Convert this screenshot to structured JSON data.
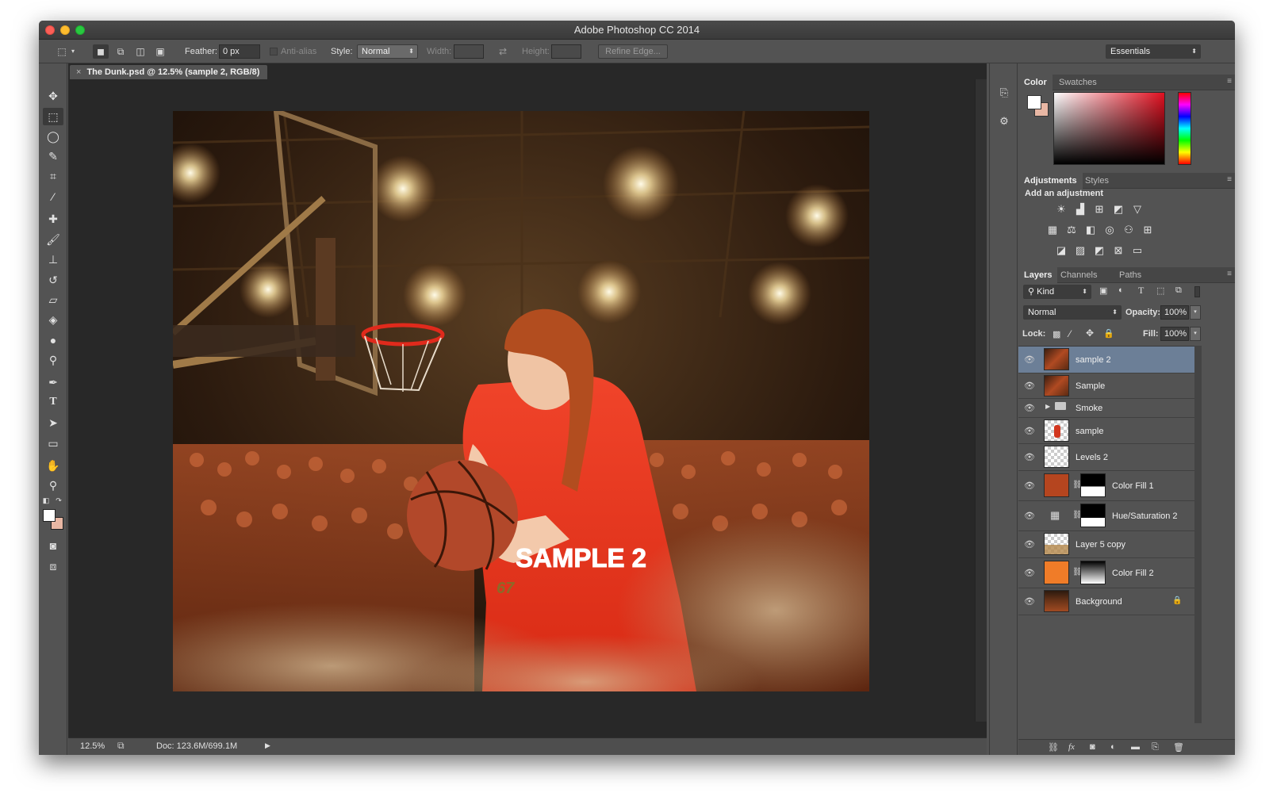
{
  "app": {
    "title": "Adobe Photoshop CC 2014"
  },
  "options": {
    "feather_label": "Feather:",
    "feather_value": "0 px",
    "antialias_label": "Anti-alias",
    "style_label": "Style:",
    "style_value": "Normal",
    "width_label": "Width:",
    "height_label": "Height:",
    "refine_edge": "Refine Edge...",
    "workspace": "Essentials"
  },
  "document": {
    "tab_title": "The Dunk.psd @ 12.5% (sample 2, RGB/8)",
    "watermark": "SAMPLE 2",
    "jersey_number": "67",
    "zoom": "12.5%",
    "doc_size": "Doc: 123.6M/699.1M"
  },
  "color_panel": {
    "tabs": [
      "Color",
      "Swatches"
    ]
  },
  "adjustments_panel": {
    "tabs": [
      "Adjustments",
      "Styles"
    ],
    "heading": "Add an adjustment"
  },
  "layers_panel": {
    "tabs": [
      "Layers",
      "Channels",
      "Paths"
    ],
    "filter": "Kind",
    "blend_mode": "Normal",
    "opacity_label": "Opacity:",
    "opacity": "100%",
    "lock_label": "Lock:",
    "fill_label": "Fill:",
    "fill": "100%",
    "layers": [
      {
        "name": "sample 2",
        "thumb": "photo",
        "selected": true
      },
      {
        "name": "Sample",
        "thumb": "photo"
      },
      {
        "name": "Smoke",
        "thumb": "folder"
      },
      {
        "name": "sample",
        "thumb": "checker-red"
      },
      {
        "name": "Levels 2",
        "thumb": "checker"
      },
      {
        "name": "Color Fill 1",
        "thumb": "fill",
        "color": "#b5451f",
        "mask": true
      },
      {
        "name": "Hue/Saturation 2",
        "thumb": "adjust",
        "mask": true
      },
      {
        "name": "Layer 5 copy",
        "thumb": "checker-photo"
      },
      {
        "name": "Color Fill 2",
        "thumb": "fill",
        "color": "#f07c28",
        "mask": true
      },
      {
        "name": "Background",
        "thumb": "photo",
        "locked": true
      }
    ]
  },
  "colors": {
    "foreground": "#ffffff",
    "background": "#e8b7a4",
    "selection": "#6c7f97",
    "fill1": "#b5451f",
    "fill2": "#f07c28"
  }
}
